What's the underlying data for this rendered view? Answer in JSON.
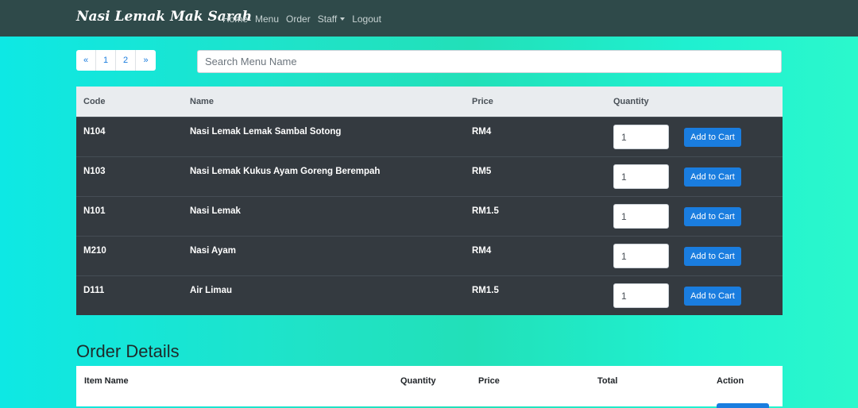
{
  "navbar": {
    "brand": "Nasi Lemak Mak Sarah",
    "links": [
      "Home",
      "Menu",
      "Order",
      "Staff",
      "Logout"
    ]
  },
  "pagination": {
    "items": [
      "«",
      "1",
      "2",
      "»"
    ]
  },
  "search": {
    "placeholder": "Search Menu Name"
  },
  "menu_table": {
    "headers": {
      "code": "Code",
      "name": "Name",
      "price": "Price",
      "quantity": "Quantity"
    },
    "rows": [
      {
        "code": "N104",
        "name": "Nasi Lemak Lemak Sambal Sotong",
        "price": "RM4",
        "quantity": "1",
        "button": "Add to Cart"
      },
      {
        "code": "N103",
        "name": "Nasi Lemak Kukus Ayam Goreng Berempah",
        "price": "RM5",
        "quantity": "1",
        "button": "Add to Cart"
      },
      {
        "code": "N101",
        "name": "Nasi Lemak",
        "price": "RM1.5",
        "quantity": "1",
        "button": "Add to Cart"
      },
      {
        "code": "M210",
        "name": "Nasi Ayam",
        "price": "RM4",
        "quantity": "1",
        "button": "Add to Cart"
      },
      {
        "code": "D111",
        "name": "Air Limau",
        "price": "RM1.5",
        "quantity": "1",
        "button": "Add to Cart"
      }
    ]
  },
  "order_details": {
    "title": "Order Details",
    "headers": {
      "item": "Item Name",
      "quantity": "Quantity",
      "price": "Price",
      "total": "Total",
      "action": "Action"
    }
  },
  "colors": {
    "navbar": "#2f4a4a",
    "table_dark": "#343a40",
    "primary": "#1a7ddf"
  }
}
